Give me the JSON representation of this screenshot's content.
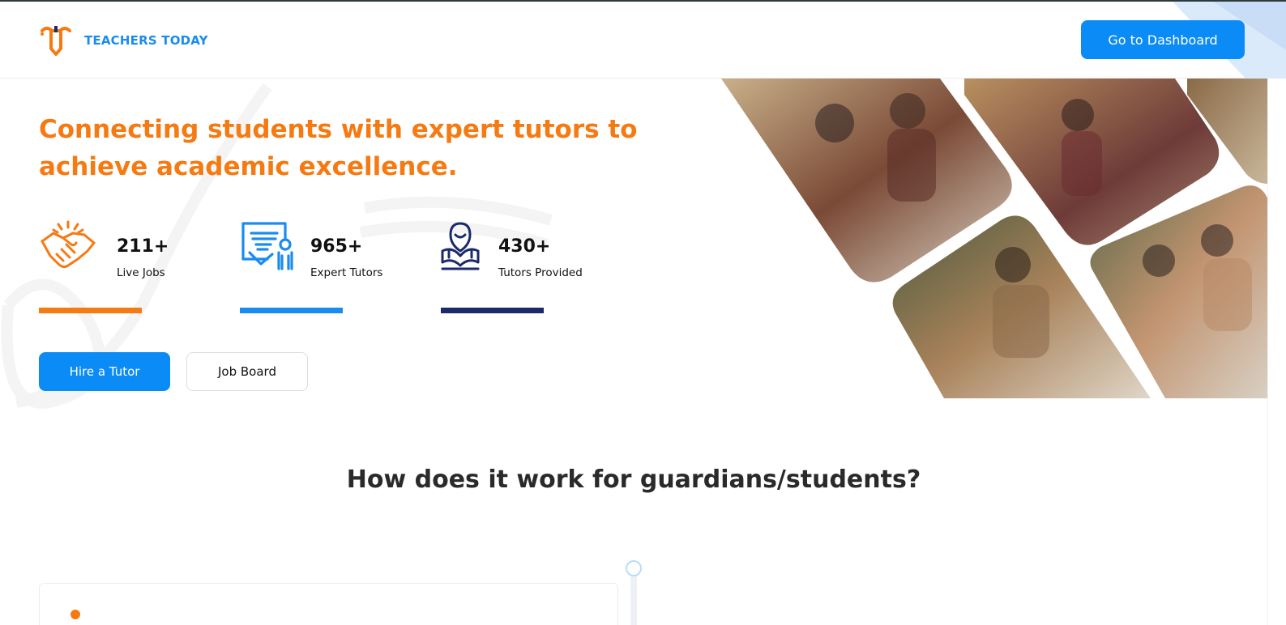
{
  "brand": {
    "name": "TEACHERS TODAY",
    "logo_icon": "teachers-today-logo",
    "primary_color": "#0b8bf5",
    "accent_color": "#f57a12",
    "navy_color": "#1b2a6b"
  },
  "header": {
    "dashboard_label": "Go to Dashboard"
  },
  "hero": {
    "headline": "Connecting students with expert tutors to achieve academic excellence.",
    "stats": [
      {
        "value": "211+",
        "label": "Live Jobs",
        "icon": "handshake-icon",
        "color": "#f57a12"
      },
      {
        "value": "965+",
        "label": "Expert Tutors",
        "icon": "certificate-icon",
        "color": "#1a8cf0"
      },
      {
        "value": "430+",
        "label": "Tutors Provided",
        "icon": "reader-icon",
        "color": "#1b2a6b"
      }
    ],
    "hire_label": "Hire a Tutor",
    "jobboard_label": "Job Board"
  },
  "section": {
    "title": "How does it work for guardians/students?"
  }
}
